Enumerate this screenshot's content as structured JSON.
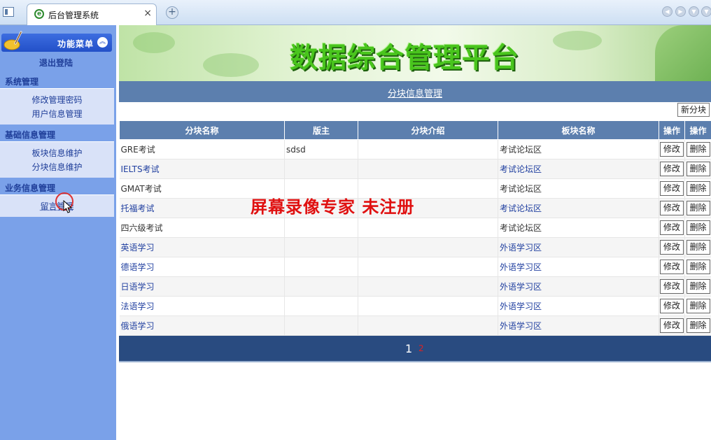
{
  "browser": {
    "tab_title": "后台管理系统",
    "tab_close": "×",
    "new_tab": "+"
  },
  "sidebar": {
    "menu_title": "功能菜单",
    "logout": "退出登陆",
    "sections": [
      {
        "title": "系统管理",
        "items": [
          "修改管理密码",
          "用户信息管理"
        ]
      },
      {
        "title": "基础信息管理",
        "items": [
          "板块信息维护",
          "分块信息维护"
        ]
      },
      {
        "title": "业务信息管理",
        "items": [
          "留言管理"
        ]
      }
    ]
  },
  "banner": {
    "title": "数据综合管理平台"
  },
  "page": {
    "subtitle": "分块信息管理",
    "new_button": "新分块",
    "watermark": "屏幕录像专家  未注册"
  },
  "table": {
    "headers": [
      "分块名称",
      "版主",
      "分块介绍",
      "板块名称",
      "操作",
      "操作"
    ],
    "edit_label": "修改",
    "delete_label": "删除",
    "rows": [
      {
        "name": "GRE考试",
        "moderator": "sdsd",
        "intro": "",
        "board": "考试论坛区"
      },
      {
        "name": "IELTS考试",
        "moderator": "",
        "intro": "",
        "board": "考试论坛区"
      },
      {
        "name": "GMAT考试",
        "moderator": "",
        "intro": "",
        "board": "考试论坛区"
      },
      {
        "name": "托福考试",
        "moderator": "",
        "intro": "",
        "board": "考试论坛区"
      },
      {
        "name": "四六级考试",
        "moderator": "",
        "intro": "",
        "board": "考试论坛区"
      },
      {
        "name": "英语学习",
        "moderator": "",
        "intro": "",
        "board": "外语学习区"
      },
      {
        "name": "德语学习",
        "moderator": "",
        "intro": "",
        "board": "外语学习区"
      },
      {
        "name": "日语学习",
        "moderator": "",
        "intro": "",
        "board": "外语学习区"
      },
      {
        "name": "法语学习",
        "moderator": "",
        "intro": "",
        "board": "外语学习区"
      },
      {
        "name": "俄语学习",
        "moderator": "",
        "intro": "",
        "board": "外语学习区"
      }
    ]
  },
  "pager": {
    "page1": "1",
    "page2": "2"
  },
  "colors": {
    "sidebar_bg": "#7aa1e9",
    "header_bar": "#5c7fae",
    "pager_bg": "#294b80",
    "banner_title": "#49c51d",
    "watermark": "#e01010"
  }
}
